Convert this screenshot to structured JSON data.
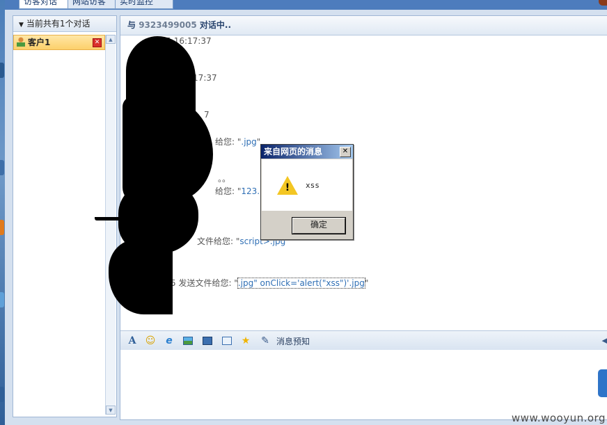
{
  "tabs": [
    {
      "label": "访客对话"
    },
    {
      "label": "网站访客"
    },
    {
      "label": "实时监控"
    }
  ],
  "left_panel": {
    "header": "当前共有1个对话",
    "clients": [
      {
        "label": "客户1"
      }
    ]
  },
  "chat": {
    "header_prefix": "与",
    "visitor_id": "9323499005",
    "header_suffix": "对话中..",
    "lines": [
      {
        "text": "005 16:17:37"
      },
      {
        "text": ":17:37"
      },
      {
        "text": "7"
      },
      {
        "prefix": "给您: \"",
        "link": ".jpg",
        "suffix": "\""
      },
      {
        "text": "。。"
      },
      {
        "prefix": "给您: \"",
        "link": "123.",
        "suffix": ""
      },
      {
        "prefix": "文件给您: \"",
        "link": "script>.jpg",
        "suffix": ""
      },
      {
        "prefix": "5 发送文件给您: \"",
        "link": ".jpg\" onClick='alert(\"xss\")'.jpg",
        "suffix": "\""
      }
    ]
  },
  "toolbar": {
    "icons": [
      "font-icon",
      "smiley-icon",
      "ie-icon",
      "image-icon",
      "screenshot-icon",
      "quick-reply-icon",
      "star-icon",
      "edit-icon"
    ],
    "preview_label": "消息预知"
  },
  "dialog": {
    "title": "来自网页的消息",
    "close": "✕",
    "message": "xss",
    "ok_label": "确定"
  },
  "watermark": "www.wooyun.org"
}
